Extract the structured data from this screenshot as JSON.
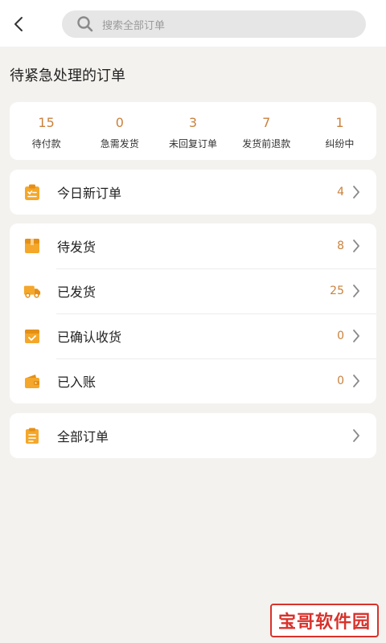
{
  "header": {
    "search_placeholder": "搜索全部订单"
  },
  "section": {
    "title": "待紧急处理的订单"
  },
  "stats": [
    {
      "value": "15",
      "label": "待付款"
    },
    {
      "value": "0",
      "label": "急需发货"
    },
    {
      "value": "3",
      "label": "未回复订单"
    },
    {
      "value": "7",
      "label": "发货前退款"
    },
    {
      "value": "1",
      "label": "纠纷中"
    }
  ],
  "today": {
    "label": "今日新订单",
    "count": "4",
    "icon": "clipboard-checklist-icon"
  },
  "orders": [
    {
      "label": "待发货",
      "count": "8",
      "icon": "box-icon"
    },
    {
      "label": "已发货",
      "count": "25",
      "icon": "truck-icon"
    },
    {
      "label": "已确认收货",
      "count": "0",
      "icon": "check-box-icon"
    },
    {
      "label": "已入账",
      "count": "0",
      "icon": "wallet-icon"
    }
  ],
  "all": {
    "label": "全部订单",
    "icon": "clipboard-icon"
  },
  "watermark": {
    "text": "宝哥软件园"
  },
  "colors": {
    "accent": "#c9823e",
    "icon": "#f4a72a",
    "background": "#f3f2ef",
    "watermark": "#d9322b"
  }
}
